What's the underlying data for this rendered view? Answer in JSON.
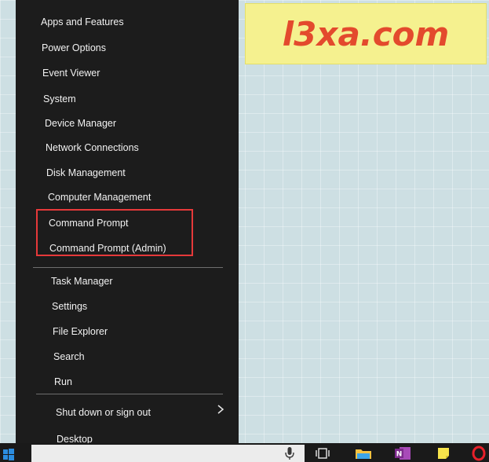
{
  "watermark": {
    "text": "l3xa.com"
  },
  "menu": {
    "group1": [
      "Apps and Features",
      "Power Options",
      "Event Viewer",
      "System",
      "Device Manager",
      "Network Connections",
      "Disk Management",
      "Computer Management",
      "Command Prompt",
      "Command Prompt (Admin)"
    ],
    "group2": [
      "Task Manager",
      "Settings",
      "File Explorer",
      "Search",
      "Run"
    ],
    "group3": [
      "Shut down or sign out",
      "Desktop"
    ]
  },
  "colors": {
    "menu_bg": "#1c1c1c",
    "menu_text": "#f2f2f2",
    "highlight_border": "#e6393a",
    "watermark_bg": "#f5f18f",
    "watermark_text": "#e34a2d"
  },
  "taskbar": {
    "icons": [
      "windows-start-icon",
      "microphone-icon",
      "task-view-icon",
      "file-explorer-icon",
      "onenote-icon",
      "sticky-notes-icon",
      "opera-icon"
    ]
  }
}
